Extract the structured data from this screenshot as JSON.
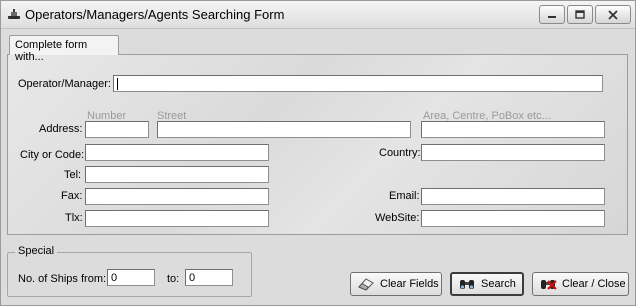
{
  "window": {
    "title": "Operators/Managers/Agents Searching Form",
    "icon": "ship-icon"
  },
  "tab": {
    "label": "Complete form with..."
  },
  "fields": {
    "operator_label": "Operator/Manager:",
    "operator_value": "",
    "address_label": "Address:",
    "address_number_hint": "Number",
    "address_street_hint": "Street",
    "address_area_hint": "Area, Centre, PoBox etc...",
    "city_label": "City or Code:",
    "country_label": "Country:",
    "tel_label": "Tel:",
    "fax_label": "Fax:",
    "email_label": "Email:",
    "tlx_label": "Tlx:",
    "website_label": "WebSite:"
  },
  "special": {
    "legend": "Special",
    "ships_from_label": "No. of Ships from:",
    "ships_from_value": "0",
    "to_label": "to:",
    "to_value": "0"
  },
  "buttons": {
    "clear_fields": "Clear Fields",
    "search": "Search",
    "clear_close": "Clear / Close"
  },
  "icons": {
    "clear_fields": "eraser-icon",
    "search": "binoculars-icon",
    "clear_close": "binoculars-close-icon"
  }
}
